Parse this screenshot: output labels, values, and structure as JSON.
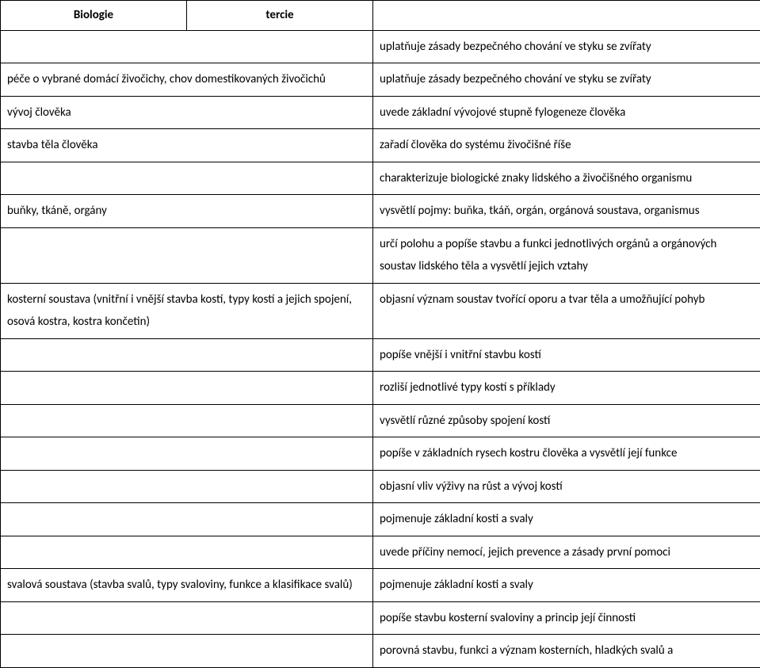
{
  "header": {
    "subject": "Biologie",
    "level": "tercie"
  },
  "rows": [
    {
      "left": "",
      "right": "uplatňuje zásady bezpečného chování ve styku se zvířaty"
    },
    {
      "left": "péče o vybrané domácí živočichy, chov domestikovaných živočichů",
      "right": "uplatňuje zásady bezpečného chování ve styku se zvířaty"
    },
    {
      "left": "vývoj člověka",
      "right": "uvede základní vývojové stupně fylogeneze člověka"
    },
    {
      "left": "stavba těla člověka",
      "right": "zařadí člověka do systému živočišné říše"
    },
    {
      "left": "",
      "right": "charakterizuje biologické znaky lidského a živočišného organismu"
    },
    {
      "left": "buňky, tkáně, orgány",
      "right": "vysvětlí pojmy: buňka, tkáň, orgán, orgánová soustava, organismus"
    },
    {
      "left": "",
      "right": "určí polohu a popíše stavbu a funkci jednotlivých orgánů a orgánových soustav lidského těla a vysvětlí jejich vztahy"
    },
    {
      "left": "kosterní soustava (vnitřní i vnější stavba kostí, typy kostí a jejich spojení, osová kostra, kostra končetin)",
      "right": "objasní význam soustav tvořící oporu a tvar těla a umožňující pohyb"
    },
    {
      "left": "",
      "right": "popíše vnější i vnitřní stavbu kostí"
    },
    {
      "left": "",
      "right": "rozliší jednotlivé typy kostí s příklady"
    },
    {
      "left": "",
      "right": "vysvětlí různé způsoby spojení kostí"
    },
    {
      "left": "",
      "right": "popíše v základních rysech kostru člověka a vysvětlí její funkce"
    },
    {
      "left": "",
      "right": "objasní vliv výživy na růst a vývoj kostí"
    },
    {
      "left": "",
      "right": "pojmenuje základní kosti a svaly"
    },
    {
      "left": "",
      "right": "uvede příčiny nemocí, jejich prevence a zásady první pomoci"
    },
    {
      "left": "svalová soustava (stavba svalů, typy svaloviny, funkce a klasifikace svalů)",
      "right": "pojmenuje základní kosti a svaly"
    },
    {
      "left": "",
      "right": "popíše stavbu kosterní svaloviny a princip její činnosti"
    },
    {
      "left": "",
      "right": "porovná stavbu, funkci a význam kosterních, hladkých svalů a"
    }
  ]
}
